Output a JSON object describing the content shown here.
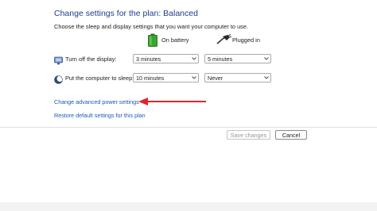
{
  "header": {
    "title": "Change settings for the plan: Balanced",
    "subtitle": "Choose the sleep and display settings that you want your computer to use."
  },
  "columns": {
    "battery_label": "On battery",
    "plugged_label": "Plugged in"
  },
  "rows": {
    "display": {
      "label": "Turn off the display:",
      "battery_value": "3 minutes",
      "plugged_value": "5 minutes"
    },
    "sleep": {
      "label": "Put the computer to sleep:",
      "battery_value": "10 minutes",
      "plugged_value": "Never"
    }
  },
  "links": {
    "advanced": "Change advanced power settings",
    "restore": "Restore default settings for this plan"
  },
  "buttons": {
    "save": "Save changes",
    "cancel": "Cancel"
  },
  "colors": {
    "title": "#1e3d8f",
    "link": "#1d5ab8",
    "arrow": "#e0242b",
    "battery_green": "#3aa631"
  }
}
